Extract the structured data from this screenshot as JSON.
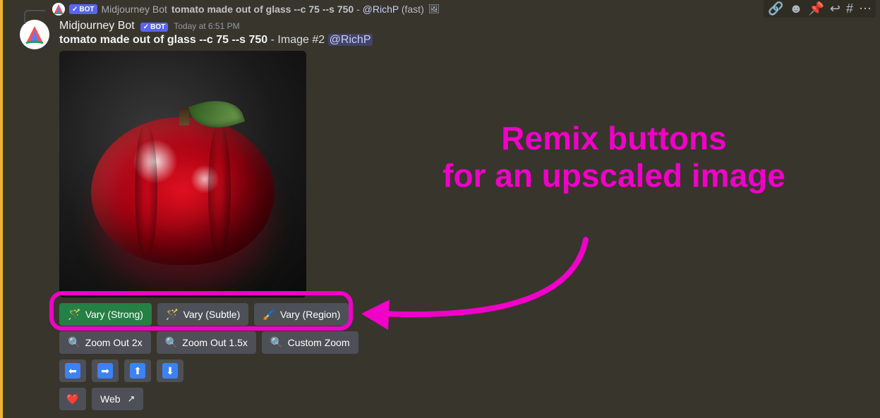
{
  "reply": {
    "author": "Midjourney Bot",
    "bot_badge": "BOT",
    "prompt": "tomato made out of glass --c 75 --s 750",
    "separator": "-",
    "mention": "@RichP",
    "mode": "(fast)"
  },
  "message": {
    "author": "Midjourney Bot",
    "bot_badge": "BOT",
    "timestamp": "Today at 6:51 PM",
    "prompt": "tomato made out of glass --c 75 --s 750",
    "image_tag": "- Image #2",
    "mention": "@RichP"
  },
  "buttons": {
    "row1": [
      {
        "emoji": "🪄",
        "label": "Vary (Strong)",
        "style": "green"
      },
      {
        "emoji": "🪄",
        "label": "Vary (Subtle)",
        "style": "grey"
      },
      {
        "emoji": "🖌️",
        "label": "Vary (Region)",
        "style": "grey"
      }
    ],
    "row2": [
      {
        "emoji": "🔍",
        "label": "Zoom Out 2x"
      },
      {
        "emoji": "🔍",
        "label": "Zoom Out 1.5x"
      },
      {
        "emoji": "🔍",
        "label": "Custom Zoom"
      }
    ],
    "row3_arrows": [
      "⬅",
      "➡",
      "⬆",
      "⬇"
    ],
    "row4": {
      "fav": "❤️",
      "web_label": "Web"
    }
  },
  "annotation": {
    "line1": "Remix buttons",
    "line2": "for an upscaled image"
  },
  "colors": {
    "highlight": "#f000c8",
    "green_button": "#248045",
    "grey_button": "#4e5058",
    "mention_fg": "#c9cdfb"
  }
}
